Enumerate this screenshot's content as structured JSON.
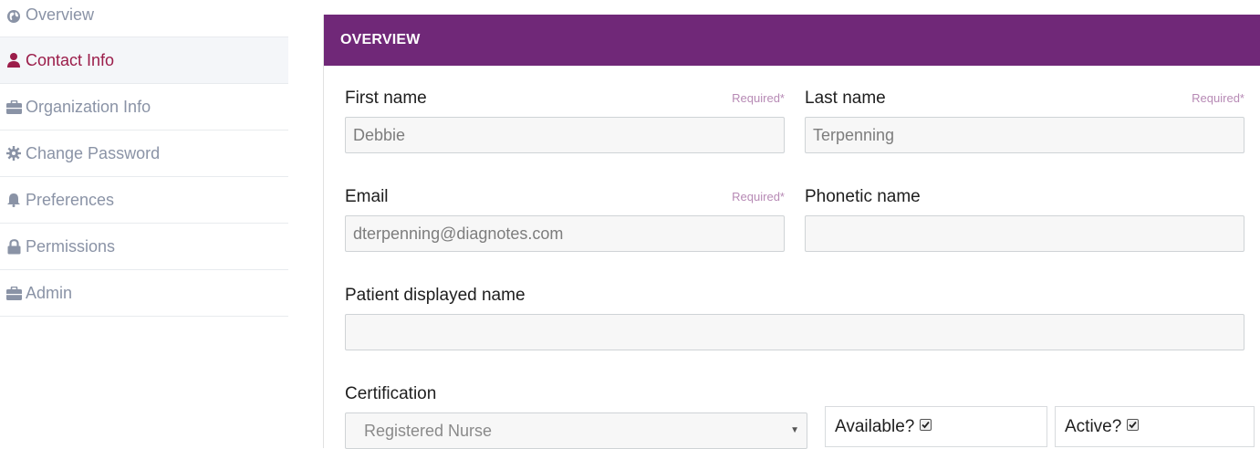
{
  "sidebar": {
    "items": [
      {
        "label": "Overview",
        "icon": "globe-icon",
        "active": false
      },
      {
        "label": "Contact Info",
        "icon": "user-icon",
        "active": true
      },
      {
        "label": "Organization Info",
        "icon": "briefcase-icon",
        "active": false
      },
      {
        "label": "Change Password",
        "icon": "gear-icon",
        "active": false
      },
      {
        "label": "Preferences",
        "icon": "bell-icon",
        "active": false
      },
      {
        "label": "Permissions",
        "icon": "lock-icon",
        "active": false
      },
      {
        "label": "Admin",
        "icon": "briefcase-icon",
        "active": false
      }
    ]
  },
  "panel": {
    "title": "OVERVIEW",
    "fields": {
      "first_name": {
        "label": "First name",
        "required": "Required*",
        "value": "Debbie"
      },
      "last_name": {
        "label": "Last name",
        "required": "Required*",
        "value": "Terpenning"
      },
      "email": {
        "label": "Email",
        "required": "Required*",
        "value": "dterpenning@diagnotes.com"
      },
      "phonetic_name": {
        "label": "Phonetic name",
        "value": ""
      },
      "patient_displayed_name": {
        "label": "Patient displayed name",
        "value": ""
      },
      "certification": {
        "label": "Certification",
        "value": "Registered Nurse"
      },
      "available": {
        "label": "Available?",
        "checked": true
      },
      "active": {
        "label": "Active?",
        "checked": true
      }
    }
  },
  "colors": {
    "header_bg": "#702878",
    "active_nav": "#9b1d4a",
    "nav_text": "#8a93a6",
    "required_text": "#b78ab5"
  }
}
